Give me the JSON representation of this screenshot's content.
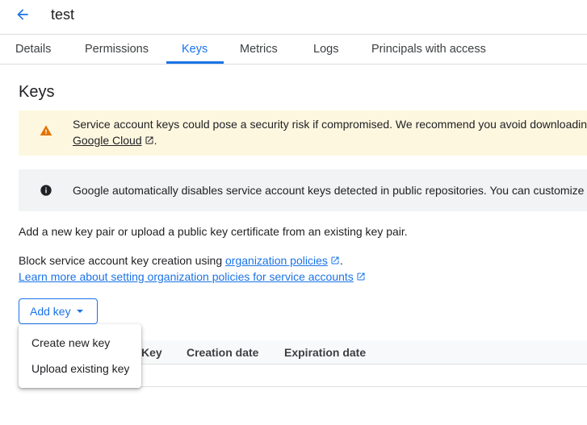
{
  "header": {
    "title": "test",
    "back_icon": "arrow-back-icon"
  },
  "tabs": [
    {
      "label": "Details",
      "active": false
    },
    {
      "label": "Permissions",
      "active": false
    },
    {
      "label": "Keys",
      "active": true
    },
    {
      "label": "Metrics",
      "active": false
    },
    {
      "label": "Logs",
      "active": false
    },
    {
      "label": "Principals with access",
      "active": false
    }
  ],
  "section": {
    "title": "Keys"
  },
  "warning_banner": {
    "icon": "warning-icon",
    "line1": "Service account keys could pose a security risk if compromised. We recommend you avoid downloadin",
    "link": "Google Cloud",
    "line2_suffix": "."
  },
  "info_banner": {
    "icon": "info-icon",
    "text": "Google automatically disables service account keys detected in public repositories. You can customize"
  },
  "body": {
    "intro": "Add a new key pair or upload a public key certificate from an existing key pair.",
    "block_prefix": "Block service account key creation using ",
    "block_link": "organization policies",
    "block_suffix": ".",
    "learn_more": "Learn more about setting organization policies for service accounts"
  },
  "add_key_button": {
    "label": "Add key"
  },
  "table": {
    "columns": [
      "Key",
      "Creation date",
      "Expiration date"
    ]
  },
  "menu": {
    "items": [
      "Create new key",
      "Upload existing key"
    ]
  },
  "colors": {
    "accent": "#1a73e8",
    "warning_bg": "#fef7e0",
    "warning_icon": "#e37400",
    "info_bg": "#f1f3f4"
  }
}
